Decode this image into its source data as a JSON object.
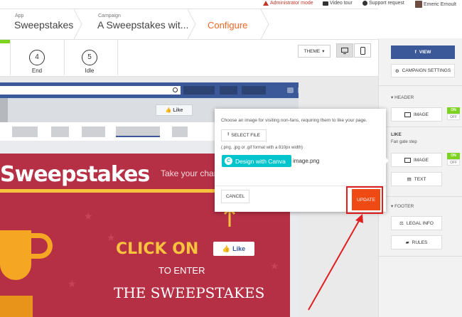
{
  "topbar": {
    "admin_mode": "Administrator mode",
    "video_tour": "Video tour",
    "support": "Support request",
    "user": "Emeric Ernoult"
  },
  "breadcrumb": {
    "app_small": "App",
    "app_name": "Sweepstakes",
    "campaign_small": "Campaign",
    "campaign_name": "A Sweepstakes wit...",
    "configure": "Configure"
  },
  "steps": [
    {
      "number": "4",
      "label": "End"
    },
    {
      "number": "5",
      "label": "Idle"
    }
  ],
  "toolbar": {
    "theme_label": "THEME"
  },
  "fb_preview": {
    "like_label": "Like"
  },
  "promo": {
    "title": "Sweepstakes",
    "tagline": "Take your chan",
    "click_on": "CLICK ON",
    "like_label": "Like",
    "to_enter": "TO ENTER",
    "the_sweepstakes": "THE SWEEPSTAKES"
  },
  "modal": {
    "instruction": "Choose an image for visiting non-fans, requiring them to like your page.",
    "select_file": "SELECT FILE",
    "format_hint": "(.png, .jpg or .gif format with a 810px width)",
    "canva_label": "Design with Canva",
    "filename": "image.png",
    "cancel": "CANCEL",
    "update": "UPDATE"
  },
  "right_panel": {
    "view": "VIEW",
    "campaign_settings": "CAMPAIGN SETTINGS",
    "header_section": "HEADER",
    "header_image": "IMAGE",
    "toggle_on": "ON",
    "toggle_off": "OFF",
    "like_section": "LIKE",
    "fan_gate": "Fan gate step",
    "like_image": "IMAGE",
    "like_text": "TEXT",
    "footer_section": "FOOTER",
    "legal_info": "LEGAL INFO",
    "rules": "RULES"
  },
  "colors": {
    "accent": "#f26522",
    "update_button": "#f04a14",
    "facebook_blue": "#3b5998",
    "canva": "#00c4cc",
    "toggle_on": "#7ed321",
    "annotation_red": "#e02020",
    "promo_bg": "#b52f45"
  }
}
